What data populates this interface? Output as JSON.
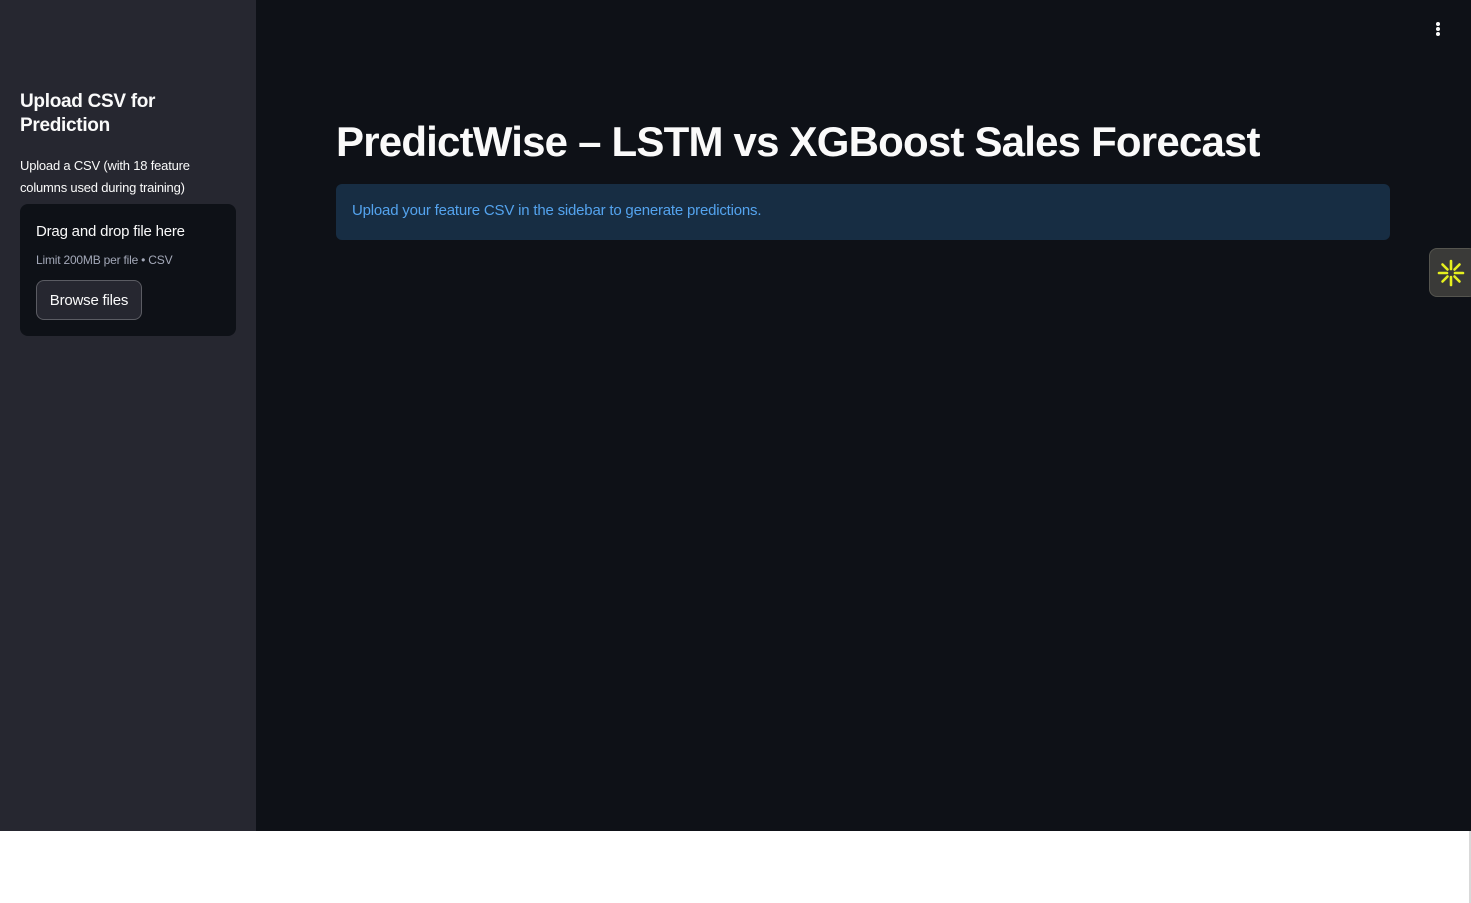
{
  "sidebar": {
    "title": "Upload CSV for Prediction",
    "description": "Upload a CSV (with 18 feature columns used during training)",
    "uploader": {
      "drop_label": "Drag and drop file here",
      "limit_text": "Limit 200MB per file • CSV",
      "browse_label": "Browse files"
    }
  },
  "main": {
    "title": "PredictWise – LSTM vs XGBoost Sales Forecast",
    "info_message": "Upload your feature CSV in the sidebar to generate predictions."
  },
  "icons": {
    "menu": "vertical-dots-icon",
    "widget": "asterisk-burst-icon"
  },
  "colors": {
    "background": "#0e1117",
    "sidebar": "#262730",
    "info_bg": "#172d43",
    "info_text": "#54a3ee",
    "widget_accent": "#e6f01e"
  }
}
